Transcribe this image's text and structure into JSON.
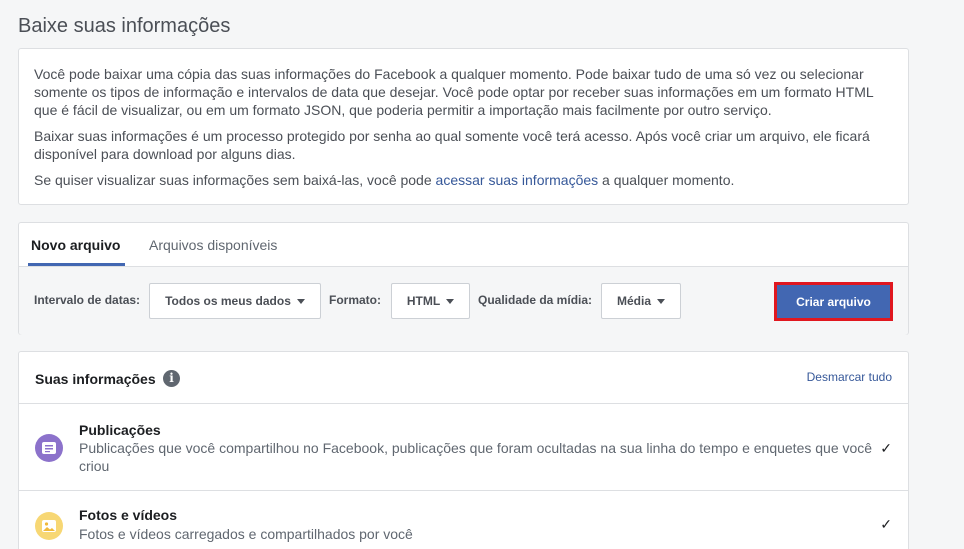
{
  "page_title": "Baixe suas informações",
  "intro": {
    "p1": "Você pode baixar uma cópia das suas informações do Facebook a qualquer momento. Pode baixar tudo de uma só vez ou selecionar somente os tipos de informação e intervalos de data que desejar. Você pode optar por receber suas informações em um formato HTML que é fácil de visualizar, ou em um formato JSON, que poderia permitir a importação mais facilmente por outro serviço.",
    "p2": "Baixar suas informações é um processo protegido por senha ao qual somente você terá acesso. Após você criar um arquivo, ele ficará disponível para download por alguns dias.",
    "p3_before": "Se quiser visualizar suas informações sem baixá-las, você pode ",
    "p3_link": "acessar suas informações",
    "p3_after": " a qualquer momento."
  },
  "tabs": {
    "new_file": "Novo arquivo",
    "available_files": "Arquivos disponíveis"
  },
  "filters": {
    "date_range_label": "Intervalo de datas:",
    "date_range_value": "Todos os meus dados",
    "format_label": "Formato:",
    "format_value": "HTML",
    "media_quality_label": "Qualidade da mídia:",
    "media_quality_value": "Média",
    "create_button": "Criar arquivo"
  },
  "info": {
    "title": "Suas informações",
    "info_icon_glyph": "i",
    "uncheck_all": "Desmarcar tudo",
    "items": [
      {
        "title": "Publicações",
        "description": "Publicações que você compartilhou no Facebook, publicações que foram ocultadas na sua linha do tempo e enquetes que você criou",
        "checked": true,
        "icon": "posts-icon",
        "icon_bg": "#8c72cb"
      },
      {
        "title": "Fotos e vídeos",
        "description": "Fotos e vídeos carregados e compartilhados por você",
        "checked": true,
        "icon": "photos-icon",
        "icon_bg": "#f7d774"
      }
    ]
  },
  "colors": {
    "accent": "#4267b2",
    "link": "#365899",
    "highlight_border": "#e0171f"
  }
}
